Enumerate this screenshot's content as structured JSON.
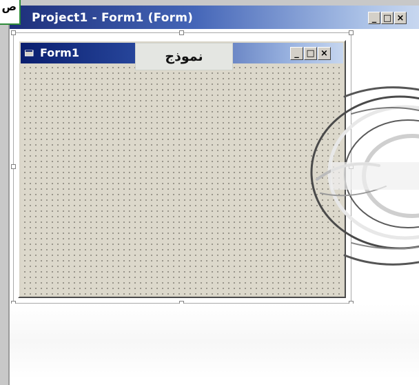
{
  "outer_window": {
    "title": "Project1 - Form1 (Form)",
    "buttons": {
      "minimize": "_",
      "maximize": "□",
      "close": "×"
    }
  },
  "corner_tab": {
    "text": "ص"
  },
  "form1": {
    "title": "Form1",
    "buttons": {
      "minimize": "_",
      "maximize": "□",
      "close": "×"
    }
  },
  "overlay_label": {
    "text": "نموذج"
  },
  "colors": {
    "titlebar_dark": "#1d2f7a",
    "titlebar_light": "#c9d8f0",
    "form_background": "#dcd8cb",
    "accent_green": "#2e8b3a"
  }
}
